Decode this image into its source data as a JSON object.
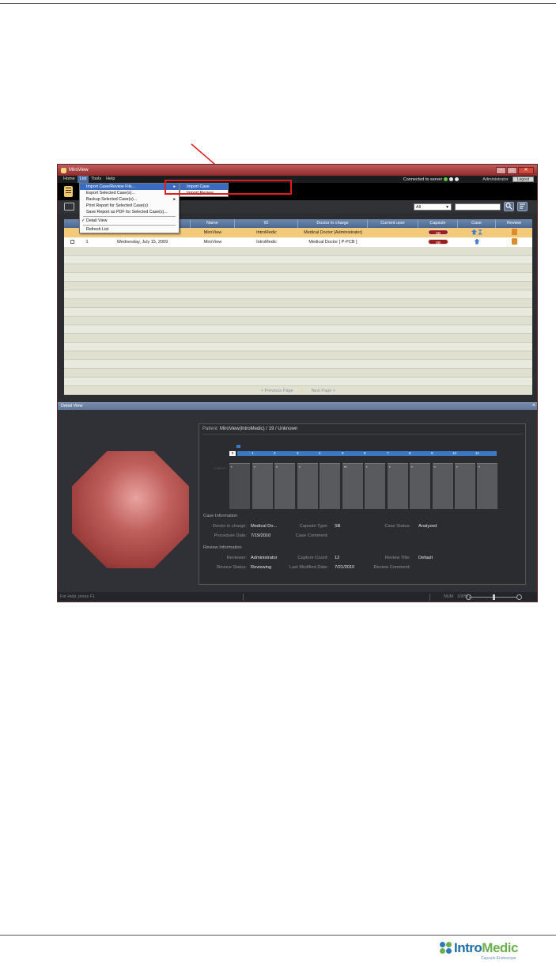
{
  "app": {
    "title": "MiroView"
  },
  "menubar": {
    "items": [
      "Home",
      "List",
      "Tools",
      "Help"
    ],
    "connection": "Connected to server",
    "user": "Administrator",
    "logout": "Logout"
  },
  "list_menu": {
    "items": [
      {
        "label": "Import Case/Review File..."
      },
      {
        "label": "Export Selected Case(s)..."
      },
      {
        "label": "Backup Selected Case(s)..."
      },
      {
        "label": "Print Report for Selected Case(s)"
      },
      {
        "label": "Save Report as PDF for Selected Case(s)..."
      },
      {
        "label": "Detail View"
      },
      {
        "label": "Refresh List"
      }
    ],
    "submenu": [
      "Import Case",
      "Import Review"
    ]
  },
  "filter": {
    "selected": "All"
  },
  "table": {
    "headers": [
      "Name",
      "ID",
      "Doctor in charge",
      "Current user",
      "Capsule",
      "Case",
      "Review"
    ],
    "rows": [
      {
        "num": "",
        "date": "",
        "name": "MiroView",
        "id": "IntroMedic",
        "doctor": "Medical Doctor [Administrator]",
        "current_user": "",
        "capsule": "SB"
      },
      {
        "num": "1",
        "date": "Wednesday, July 15, 2009",
        "name": "MiroView",
        "id": "IntroMedic",
        "doctor": "Medical Doctor [ P-PCB ]",
        "current_user": "",
        "capsule": "SB"
      }
    ]
  },
  "pager": {
    "prev": "< Previous Page",
    "current": "1",
    "next": "Next Page >"
  },
  "detail": {
    "title": "Detail View",
    "patient_label": "Patient:",
    "patient_value": "MiroView(IntroMedic) / 19 / Unknown",
    "timeline_start": "0",
    "timeline_marks": [
      "1",
      "2",
      "3",
      "4",
      "5",
      "6",
      "7",
      "8",
      "9",
      "10",
      "11"
    ],
    "capture_label": "Capture",
    "capture_marks": [
      "*",
      "*",
      "*",
      "*",
      "",
      "**",
      "*",
      "*",
      "*",
      "*",
      "*",
      "*"
    ],
    "case_info_title": "Case Information",
    "case_info": {
      "doctor_label": "Doctor in charge:",
      "doctor_value": "Medical Do...",
      "capsule_type_label": "Capsule Type:",
      "capsule_type_value": "SB",
      "case_status_label": "Case Status:",
      "case_status_value": "Analyzed",
      "procedure_date_label": "Procedure Date:",
      "procedure_date_value": "7/19/2010",
      "case_comment_label": "Case Comment:"
    },
    "review_info_title": "Review Information",
    "review_info": {
      "reviewer_label": "Reviewer:",
      "reviewer_value": "Administrator",
      "capture_count_label": "Capture Count:",
      "capture_count_value": "12",
      "review_title_label": "Review Title:",
      "review_title_value": "Default",
      "review_status_label": "Review Status:",
      "review_status_value": "Reviewing",
      "last_modified_label": "Last Modified Date:",
      "last_modified_value": "7/21/2010",
      "review_comment_label": "Review Comment:"
    }
  },
  "statusbar": {
    "help": "For Help, press F1",
    "num": "NUM",
    "zoom": "100%"
  },
  "footer": {
    "brand_a": "Intro",
    "brand_b": "Medic",
    "tagline": "Capsule Endoscope"
  },
  "colors": {
    "accent": "#4a6fa5",
    "selected_row": "#f3c97a",
    "annotation": "#e21b1b",
    "titlebar": "#b0443f"
  }
}
